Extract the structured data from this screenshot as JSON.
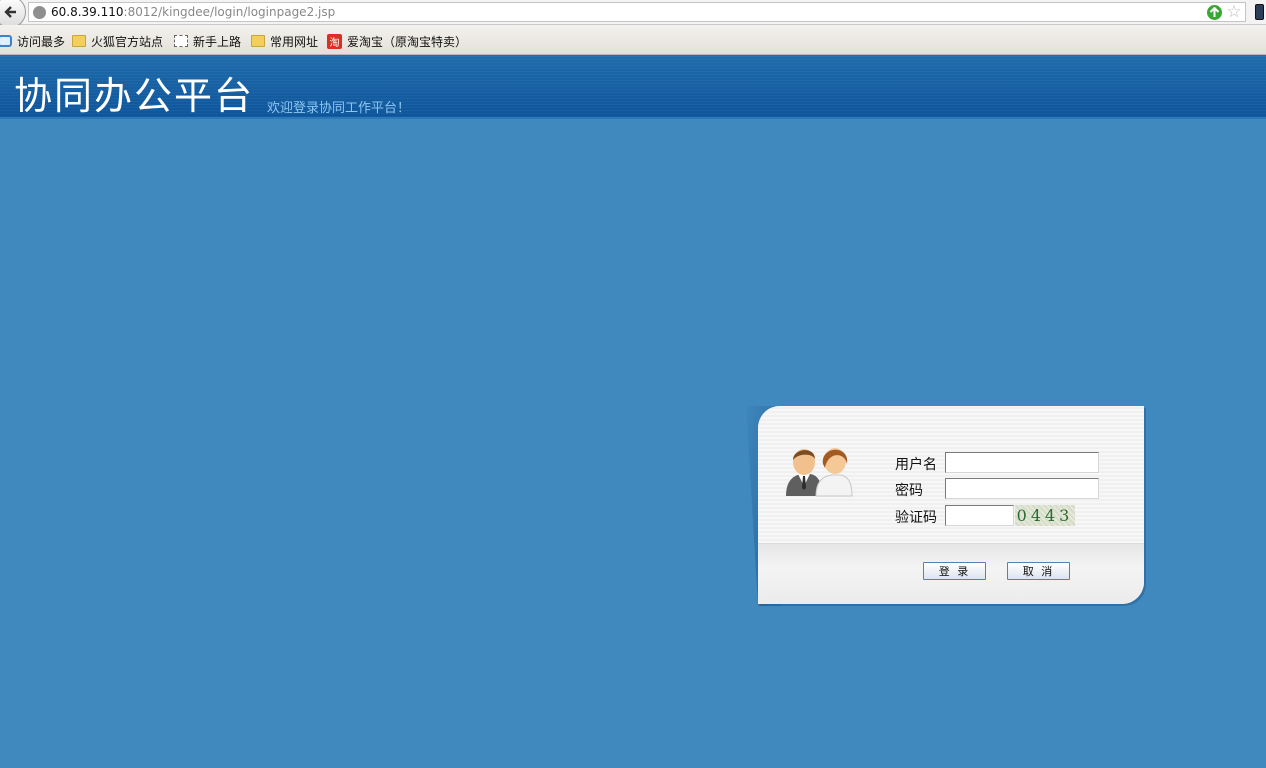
{
  "browser": {
    "url_host": "60.8.39.110",
    "url_rest": ":8012/kingdee/login/loginpage2.jsp",
    "bookmarks": [
      {
        "label": "访问最多",
        "icon": "search-icon"
      },
      {
        "label": "火狐官方站点",
        "icon": "folder-icon"
      },
      {
        "label": "新手上路",
        "icon": "page-icon"
      },
      {
        "label": "常用网址",
        "icon": "folder-icon"
      },
      {
        "label": "爱淘宝（原淘宝特卖）",
        "icon": "taobao-icon",
        "icon_text": "淘"
      }
    ]
  },
  "header": {
    "title": "协同办公平台",
    "subtitle": "欢迎登录协同工作平台！"
  },
  "login": {
    "username_label": "用户名",
    "username_value": "",
    "password_label": "密码",
    "password_value": "",
    "captcha_label": "验证码",
    "captcha_value": "",
    "captcha_code": "0443",
    "login_button": "登 录",
    "cancel_button": "取 消"
  },
  "colors": {
    "page_bg": "#4089bf",
    "header_bg": "#1262a5",
    "subtitle": "#8cc6f2"
  }
}
